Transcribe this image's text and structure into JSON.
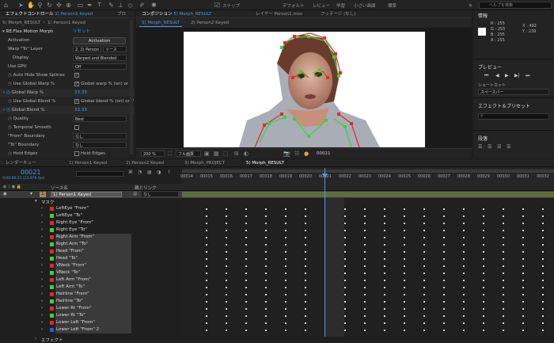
{
  "toolbar": {
    "snap_label": "スナップ",
    "workspaces": [
      "デフォルト",
      "レビュー",
      "学習",
      "小さい画面",
      "標準"
    ],
    "search_placeholder": "ヘルプを検索"
  },
  "effect_panel": {
    "tab_label": "エフェクトコントロール",
    "tab_target": "1) Person1 Keyed",
    "tab_more": "プロ",
    "header": "5) Morph_RESULT ・ 1) Person1 Keyed",
    "effect_name": "RE:Flex Motion Morph",
    "reset_label": "リセット",
    "activation_label": "Activation",
    "activation_button": "Activation",
    "warp_layer_label": "Warp \"To\" Layer",
    "warp_layer_value": "2. 2) Person",
    "warp_source_value": "ソース",
    "display_label": "Display",
    "display_value": "Warped and Blended",
    "gpu_label": "Use GPU",
    "gpu_value": "Off",
    "auto_hide_label": "Auto Hide Show Splines",
    "use_warp_label": "Use Global Warp %",
    "use_warp_text": "Global warp % (on) or P",
    "global_warp_label": "Global Warp %",
    "global_warp_value": "33.33",
    "use_blend_label": "Use Global Blend %",
    "use_blend_text": "Global blend % (on) or P",
    "global_blend_label": "Global Blend %",
    "global_blend_value": "33.33",
    "quality_label": "Quality",
    "quality_value": "Best",
    "temporal_label": "Temporal Smooth",
    "from_boundary_label": "\"From\" Boundary",
    "from_boundary_value": "なし",
    "to_boundary_label": "\"To\" Boundary",
    "to_boundary_value": "なし",
    "hold_edges_label": "Hold Edges",
    "hold_edges_value": "Hold Edges"
  },
  "comp_panel": {
    "tab_label": "コンポジション",
    "tab_target": "5) Morph_RESULT",
    "layer_tab": "レイヤー Person1.mov",
    "footage_tab": "フッテージ (なし)",
    "subtabs": [
      "5) Morph_RESULT",
      "2) Person2 Keyed"
    ],
    "zoom": "200 %",
    "quality": "フル画質",
    "timecode": "00021"
  },
  "info_panel": {
    "title": "情報",
    "r": "R : 255",
    "g": "G : 255",
    "b": "B : 255",
    "a": "A : 255",
    "x": "X : 492",
    "y": "Y : 239"
  },
  "preview_panel": {
    "title": "プレビュー",
    "shortcut_label": "ショートカット",
    "shortcut_value": "スペースバー"
  },
  "effects_presets": {
    "title": "エフェクト＆プリセット",
    "search": ""
  },
  "align_panel": {
    "title": "段落"
  },
  "timeline": {
    "render_queue": "レンダーキュー",
    "timecode": "00021",
    "fps": "0:00:00:21 (23.976 fps)",
    "tabs": [
      "1) Person1 Keyed",
      "2) Person2 Keyed",
      "3) Morph_PROJECT",
      "5) Morph_RESULT"
    ],
    "col_source": "ソース名",
    "col_parent": "親とリンク",
    "layer_num": "1",
    "layer_name": "1) Person1 Keyed",
    "parent_value": "なし",
    "masks_label": "マスク",
    "effects_label": "エフェクト",
    "ruler": [
      "00014",
      "00015",
      "00016",
      "00017",
      "00018",
      "00019",
      "00020",
      "00021",
      "00022",
      "00023",
      "00024",
      "00025",
      "00026",
      "00027",
      "00028",
      "00029",
      "00030",
      "00031",
      "00032"
    ],
    "masks": [
      {
        "name": "LeftEye \"From\"",
        "color": "#e8262a"
      },
      {
        "name": "LeftEye \"To\"",
        "color": "#36d43c"
      },
      {
        "name": "Right Eye \"From\"",
        "color": "#e8262a"
      },
      {
        "name": "Right Eye \"To\"",
        "color": "#36d43c"
      },
      {
        "name": "Right Arm \"From\"",
        "color": "#e8262a"
      },
      {
        "name": "Right Arm \"To\"",
        "color": "#36d43c"
      },
      {
        "name": "Head \"From\"",
        "color": "#e8262a"
      },
      {
        "name": "Head \"To\"",
        "color": "#36d43c"
      },
      {
        "name": "VNeck \"From\"",
        "color": "#e8262a"
      },
      {
        "name": "VNeck \"To\"",
        "color": "#36d43c"
      },
      {
        "name": "Left Arm \"From\"",
        "color": "#e8262a"
      },
      {
        "name": "Left Arm \"To\"",
        "color": "#36d43c"
      },
      {
        "name": "Hairline \"From\"",
        "color": "#e8262a"
      },
      {
        "name": "Hairline \"To\"",
        "color": "#36d43c"
      },
      {
        "name": "Lower Rt \"From\"",
        "color": "#e8262a"
      },
      {
        "name": "Lower Rt \"To\"",
        "color": "#36d43c"
      },
      {
        "name": "Lower Left \"From\"",
        "color": "#e8262a"
      },
      {
        "name": "Lower Left \"From\" 2",
        "color": "#2e5cd6"
      }
    ]
  }
}
